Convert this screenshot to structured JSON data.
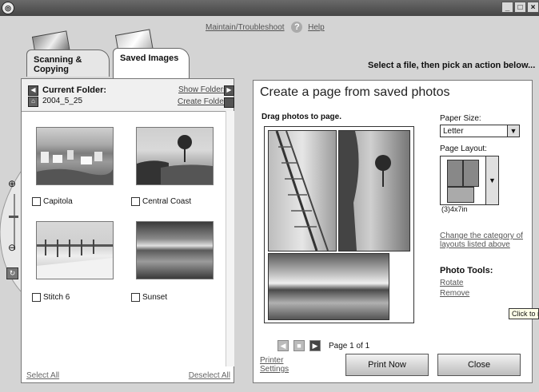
{
  "window": {
    "controls": [
      "_",
      "□",
      "×"
    ]
  },
  "toplinks": {
    "maintain": "Maintain/Troubleshoot",
    "help": "Help"
  },
  "tabs": [
    {
      "label": "Scanning & Copying"
    },
    {
      "label": "Saved Images"
    }
  ],
  "instruction": "Select a file, then pick an action below...",
  "left_panel": {
    "current_folder_label": "Current Folder:",
    "folder_name": "2004_5_25",
    "show_folders": "Show Folders",
    "create_folder": "Create Folder",
    "photos": [
      {
        "name": "Capitola"
      },
      {
        "name": "Central Coast"
      },
      {
        "name": "Stitch 6"
      },
      {
        "name": "Sunset"
      }
    ],
    "select_all": "Select All",
    "deselect_all": "Deselect All"
  },
  "right_panel": {
    "title": "Create a page from saved photos",
    "drag_hint": "Drag photos to page.",
    "paper_size_label": "Paper Size:",
    "paper_size_value": "Letter",
    "page_layout_label": "Page Layout:",
    "layout_caption": "(3)4x7in",
    "change_category": "Change the category of layouts listed above",
    "photo_tools_title": "Photo Tools:",
    "rotate": "Rotate",
    "remove": "Remove",
    "page_indicator": "Page 1 of 1",
    "printer_settings": "Printer Settings",
    "print_now": "Print Now",
    "close": "Close"
  },
  "tooltip": "Click to r"
}
